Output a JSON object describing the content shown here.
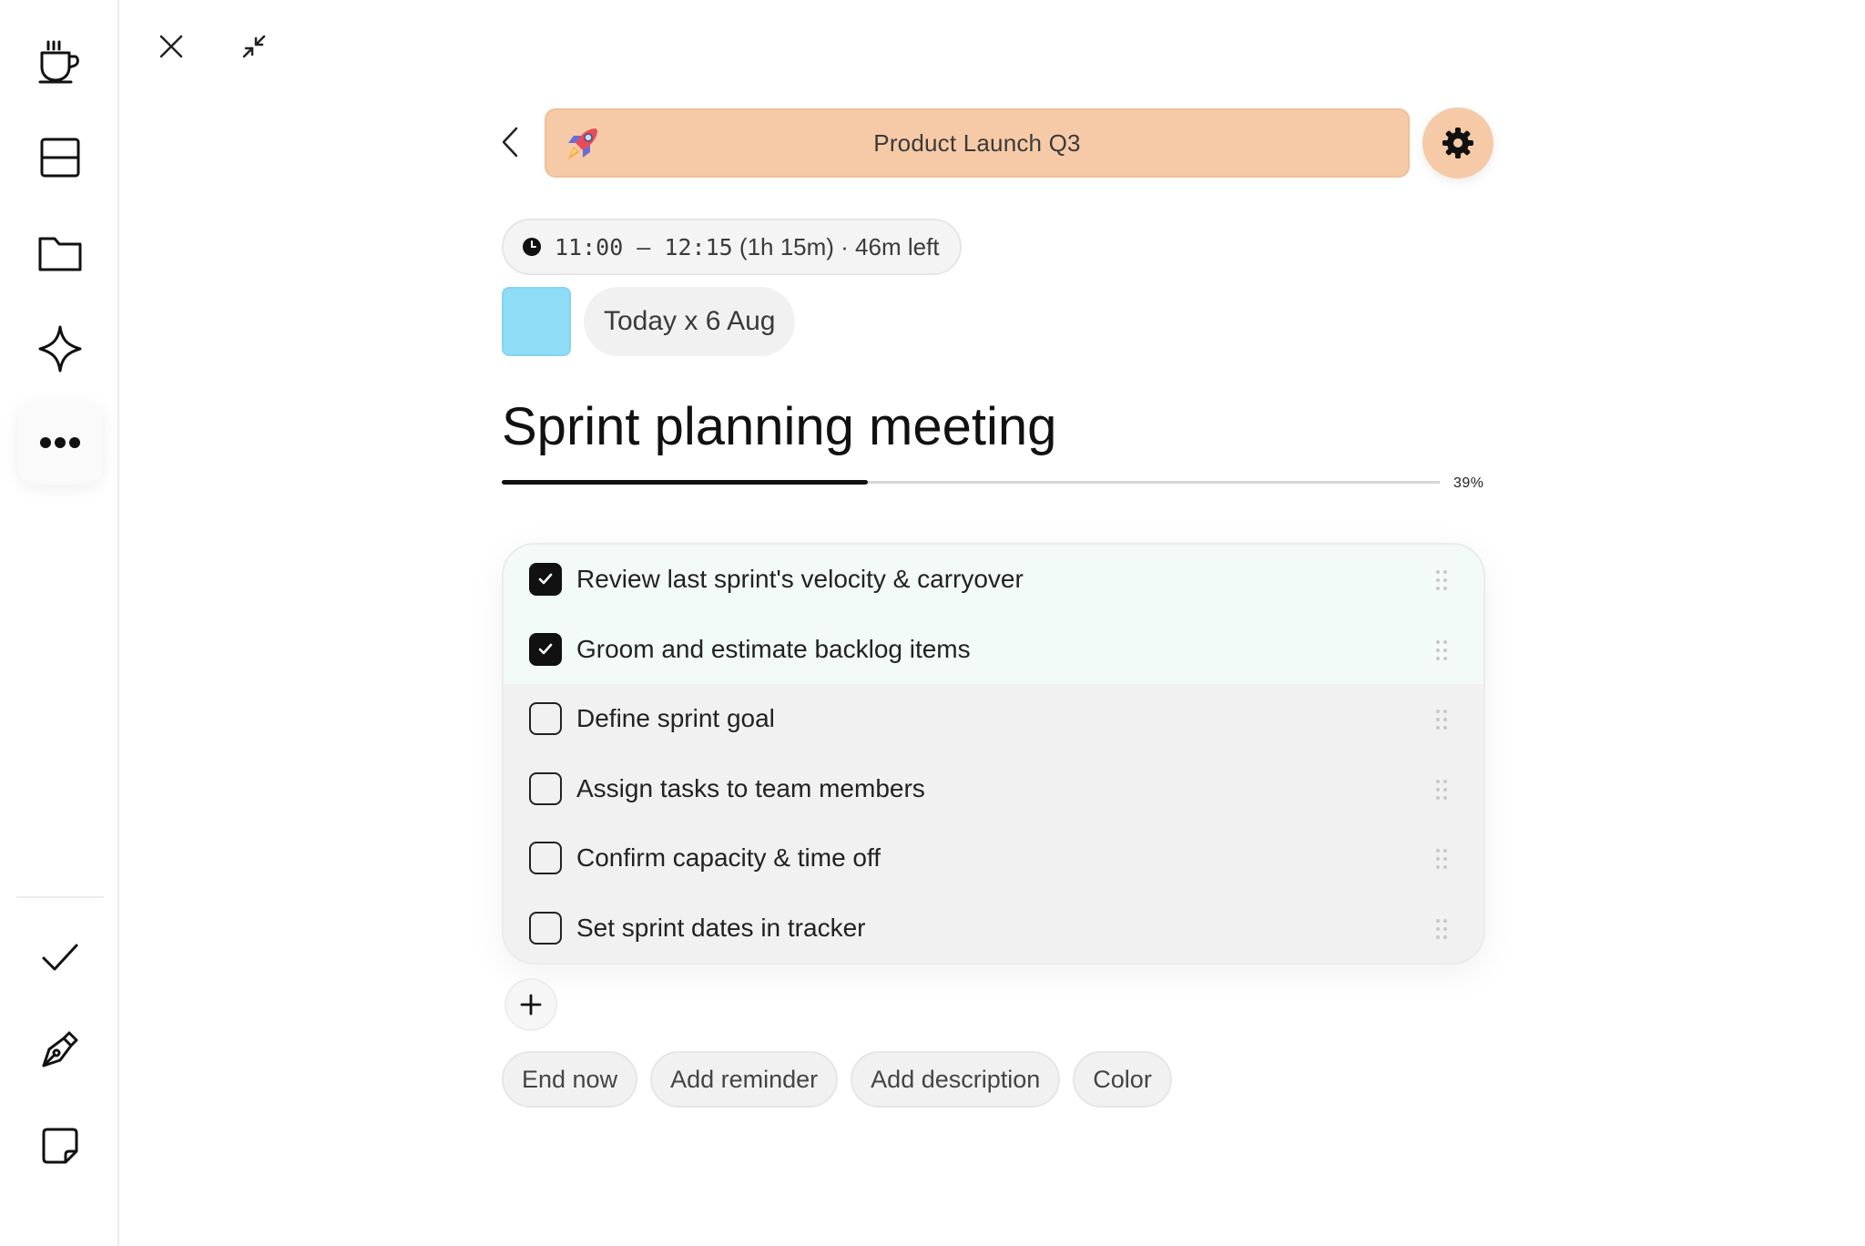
{
  "sidebar": {
    "top_items": [
      {
        "icon": "coffee-cup-icon"
      },
      {
        "icon": "layout-rows-icon"
      },
      {
        "icon": "folder-icon"
      },
      {
        "icon": "sparkle-icon"
      },
      {
        "icon": "more-dots-icon"
      }
    ],
    "bottom_items": [
      {
        "icon": "checkmark-icon"
      },
      {
        "icon": "pen-nib-icon"
      },
      {
        "icon": "sticky-note-icon"
      }
    ]
  },
  "window": {
    "close_icon": "close-icon",
    "minimize_icon": "collapse-icon"
  },
  "header": {
    "project_title": "Product Launch Q3",
    "project_color": "#f6caa6"
  },
  "event": {
    "time_range": "11:00 — 12:15",
    "time_suffix": "(1h 15m) · 46m left",
    "date": "Today x 6 Aug",
    "color": "#8fdcf7",
    "title": "Sprint planning meeting",
    "progress": 0.39,
    "progress_label": "39%"
  },
  "checklist": [
    {
      "label": "Review last sprint's velocity & carryover",
      "checked": true
    },
    {
      "label": "Groom and estimate backlog items",
      "checked": true
    },
    {
      "label": "Define sprint goal",
      "checked": false
    },
    {
      "label": "Assign tasks to team members",
      "checked": false
    },
    {
      "label": "Confirm capacity & time off",
      "checked": false
    },
    {
      "label": "Set sprint dates in tracker",
      "checked": false
    }
  ],
  "actions": {
    "end_now": "End now",
    "add_reminder": "Add reminder",
    "add_description": "Add description",
    "color": "Color"
  }
}
